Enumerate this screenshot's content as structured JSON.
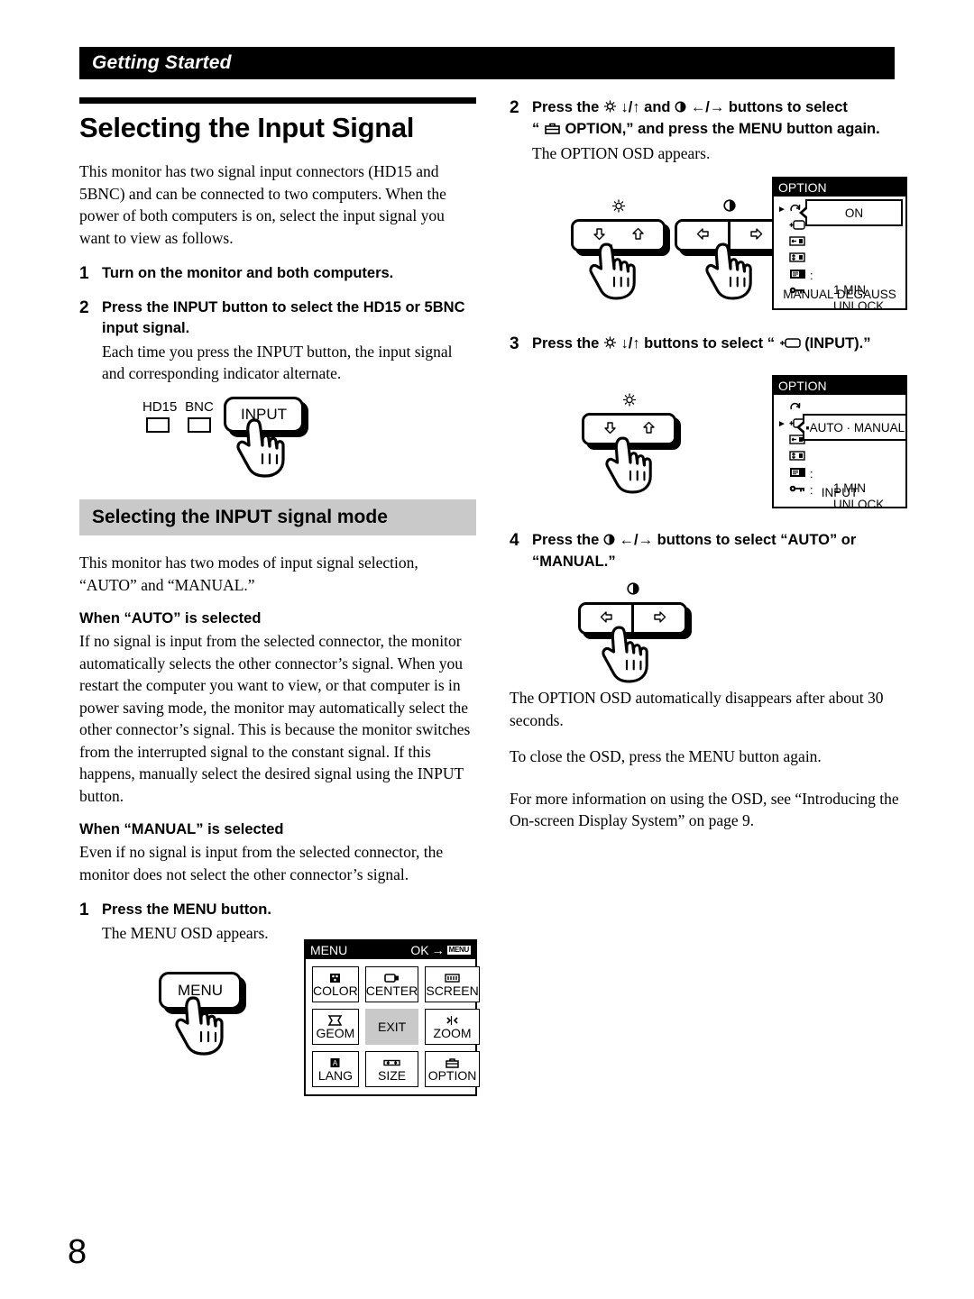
{
  "running_head": "Getting Started",
  "page_number": "8",
  "left": {
    "title": "Selecting the Input Signal",
    "intro": "This monitor has two signal input connectors (HD15 and 5BNC) and can be connected to two computers. When the power of both computers is on, select the input signal you want to view as follows.",
    "steps": [
      {
        "num": "1",
        "lead": "Turn on the monitor and both computers.",
        "sub": ""
      },
      {
        "num": "2",
        "lead": "Press the INPUT button to select the HD15 or 5BNC input signal.",
        "sub": "Each time you press the INPUT button, the input signal and corresponding indicator alternate."
      }
    ],
    "input_figure": {
      "led1": "HD15",
      "led2": "BNC",
      "button": "INPUT"
    },
    "banner": "Selecting the INPUT signal mode",
    "modes_intro": "This monitor has two modes of input signal selection, “AUTO” and “MANUAL.”",
    "auto_head": "When “AUTO” is selected",
    "auto_body": "If no signal is input from the selected connector, the monitor automatically selects the other connector’s signal. When you restart the computer you want to view, or that computer is in power saving mode, the monitor may automatically select the other connector’s signal.  This is because the monitor switches from the interrupted signal to the constant signal. If this happens, manually select the desired signal using the INPUT button.",
    "manual_head": "When “MANUAL” is selected",
    "manual_body": "Even if no signal is input from the selected connector, the monitor does not select the other connector’s signal.",
    "step1": {
      "num": "1",
      "lead": "Press the MENU button.",
      "sub": "The MENU OSD appears."
    },
    "menu_button_label": "MENU",
    "menu_osd": {
      "title": "MENU",
      "ok_label": "OK",
      "ok_arrow": "→",
      "ok_badge": "MENU",
      "cells": [
        {
          "label": "COLOR",
          "icon": "color-icon",
          "selected": false
        },
        {
          "label": "CENTER",
          "icon": "center-icon",
          "selected": false
        },
        {
          "label": "SCREEN",
          "icon": "screen-icon",
          "selected": false
        },
        {
          "label": "GEOM",
          "icon": "geometry-icon",
          "selected": false
        },
        {
          "label": "EXIT",
          "icon": "",
          "selected": true
        },
        {
          "label": "ZOOM",
          "icon": "zoom-icon",
          "selected": false
        },
        {
          "label": "LANG",
          "icon": "language-icon",
          "selected": false
        },
        {
          "label": "SIZE",
          "icon": "size-icon",
          "selected": false
        },
        {
          "label": "OPTION",
          "icon": "option-icon",
          "selected": false
        }
      ]
    }
  },
  "right": {
    "step2": {
      "num": "2",
      "lead_a": "Press the",
      "lead_b": "↓/↑ and",
      "lead_c": "←/→ buttons to select",
      "lead_d": "“",
      "lead_e": "OPTION,” and press the MENU button again.",
      "sub": "The OPTION OSD appears."
    },
    "step3": {
      "num": "3",
      "lead_a": "Press the",
      "lead_b": "↓/↑ buttons to select “",
      "lead_c": "(INPUT).”"
    },
    "step4": {
      "num": "4",
      "lead_a": "Press the",
      "lead_b": "←/→ buttons to select “AUTO” or “MANUAL.”"
    },
    "osd1": {
      "title": "OPTION",
      "callout": "ON",
      "rows": [
        {
          "icon": "degauss-icon",
          "cursor": true
        },
        {
          "icon": "input-connector-icon",
          "cursor": false
        },
        {
          "icon": "osd-h-position-icon",
          "cursor": false
        },
        {
          "icon": "osd-v-position-icon",
          "cursor": false
        },
        {
          "icon": "osd-timer-icon",
          "cursor": false,
          "colon": ":",
          "value": "1 MIN"
        },
        {
          "icon": "key-lock-icon",
          "cursor": false,
          "colon": ":",
          "value": "UNLOCK"
        }
      ],
      "footer": "MANUAL  DEGAUSS"
    },
    "osd2": {
      "title": "OPTION",
      "callout": "▪AUTO · MANUAL",
      "rows": [
        {
          "icon": "degauss-icon",
          "cursor": false
        },
        {
          "icon": "input-connector-icon",
          "cursor": true
        },
        {
          "icon": "osd-h-position-icon",
          "cursor": false
        },
        {
          "icon": "osd-v-position-icon",
          "cursor": false
        },
        {
          "icon": "osd-timer-icon",
          "cursor": false,
          "colon": ":",
          "value": "1 MIN"
        },
        {
          "icon": "key-lock-icon",
          "cursor": false,
          "colon": ":",
          "value": "UNLOCK"
        }
      ],
      "footer": "INPUT"
    },
    "closing_1": "The OPTION OSD automatically disappears after about 30 seconds.",
    "closing_2": "To close the OSD, press the MENU button again.",
    "closing_3": "For more information on using the OSD, see “Introducing the On-screen Display System” on page 9."
  }
}
